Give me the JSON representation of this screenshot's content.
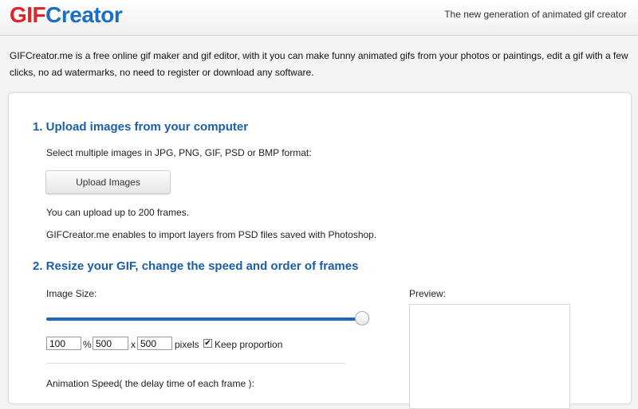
{
  "header": {
    "logo_gif": "GIF",
    "logo_creator": "Creator",
    "tagline": "The new generation of animated gif creator"
  },
  "intro": "GIFCreator.me is a free online gif maker and gif editor, with it you can make funny animated gifs from your photos or paintings, edit a gif with a few clicks, no ad watermarks, no need to register or download any software.",
  "step1": {
    "title": "1. Upload images from your computer",
    "formats": "Select multiple images in JPG, PNG, GIF, PSD or BMP format:",
    "upload_button": "Upload Images",
    "limit": "You can upload up to 200 frames.",
    "psd_note": "GIFCreator.me enables to import layers from PSD files saved with Photoshop."
  },
  "step2": {
    "title": "2. Resize your GIF, change the speed and order of frames",
    "image_size_label": "Image Size:",
    "slider_percent": 100,
    "percent_value": "100",
    "percent_sign": "%",
    "width_value": "500",
    "times_sign": "x",
    "height_value": "500",
    "unit": "pixels",
    "keep_proportion_label": "Keep proportion",
    "keep_proportion_checked": true,
    "speed_label": "Animation Speed( the delay time of each frame ):",
    "preview_label": "Preview:"
  },
  "colors": {
    "logo_gif": "#e0252a",
    "logo_creator": "#1a6fc4",
    "heading": "#1a5fa8",
    "slider": "#2166c0"
  }
}
